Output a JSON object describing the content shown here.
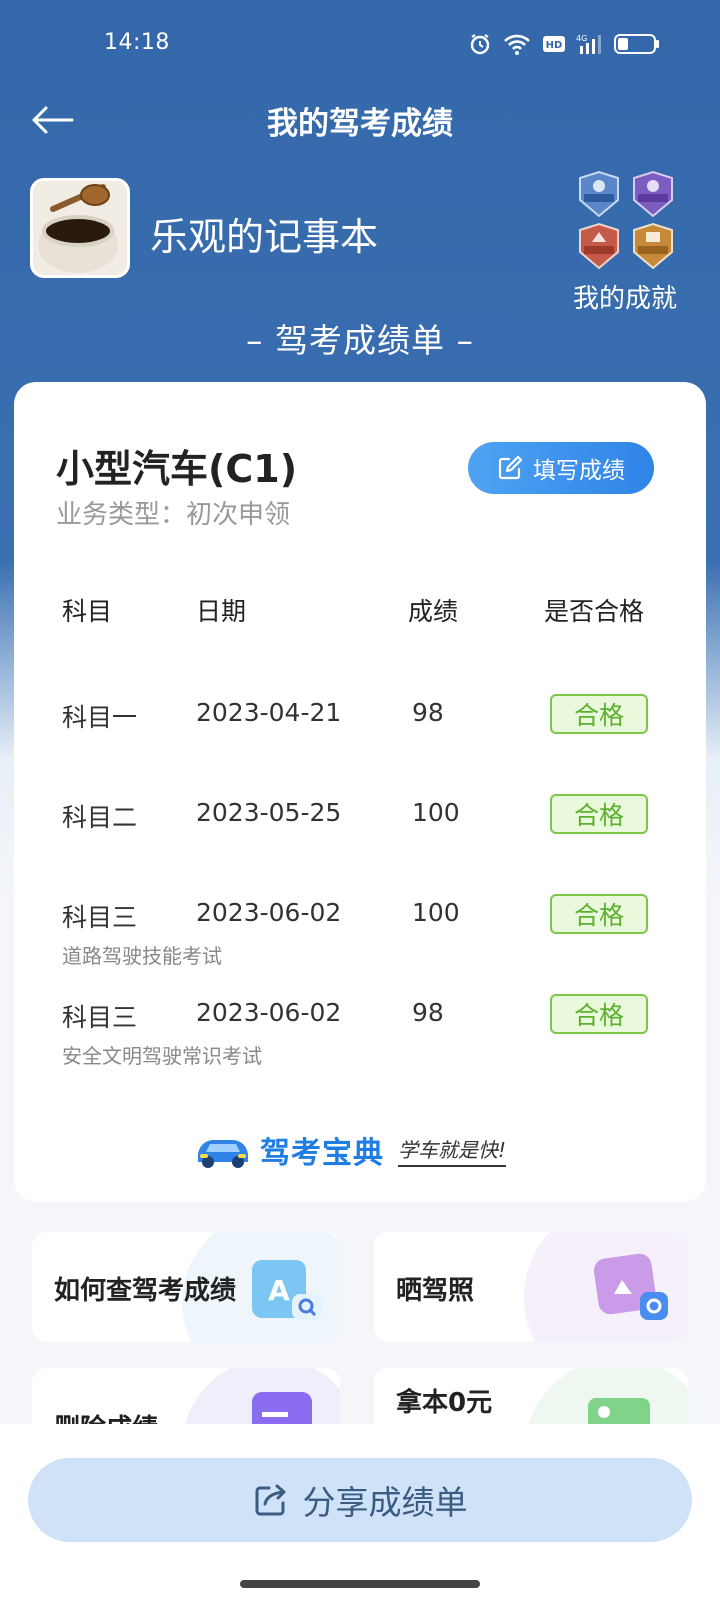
{
  "status_bar": {
    "time": "14:18"
  },
  "header": {
    "title": "我的驾考成绩",
    "back_icon": "back-arrow-icon"
  },
  "profile": {
    "name": "乐观的记事本",
    "achievements_label": "我的成就"
  },
  "section_title": "– 驾考成绩单 –",
  "card": {
    "license_type": "小型汽车(C1)",
    "business_type": "业务类型：初次申领",
    "fill_button": "填写成绩",
    "table": {
      "headers": [
        "科目",
        "日期",
        "成绩",
        "是否合格"
      ],
      "rows": [
        {
          "subject": "科目一",
          "sub_label": "",
          "date": "2023-04-21",
          "score": "98",
          "status": "合格"
        },
        {
          "subject": "科目二",
          "sub_label": "",
          "date": "2023-05-25",
          "score": "100",
          "status": "合格"
        },
        {
          "subject": "科目三",
          "sub_label": "道路驾驶技能考试",
          "date": "2023-06-02",
          "score": "100",
          "status": "合格"
        },
        {
          "subject": "科目三",
          "sub_label": "安全文明驾驶常识考试",
          "date": "2023-06-02",
          "score": "98",
          "status": "合格"
        }
      ]
    },
    "brand": {
      "name": "驾考宝典",
      "slogan": "学车就是快!"
    }
  },
  "tiles": [
    {
      "label": "如何查驾考成绩",
      "icon": "search-doc-icon"
    },
    {
      "label": "晒驾照",
      "icon": "photo-share-icon"
    },
    {
      "label": "删除成绩",
      "icon": "delete-doc-icon"
    },
    {
      "label": "拿本0元",
      "icon": "license-card-icon"
    }
  ],
  "share_button": "分享成绩单",
  "colors": {
    "primary_bg": "#3468aa",
    "accent_blue": "#2f83e6",
    "pass_green": "#5cb030"
  }
}
